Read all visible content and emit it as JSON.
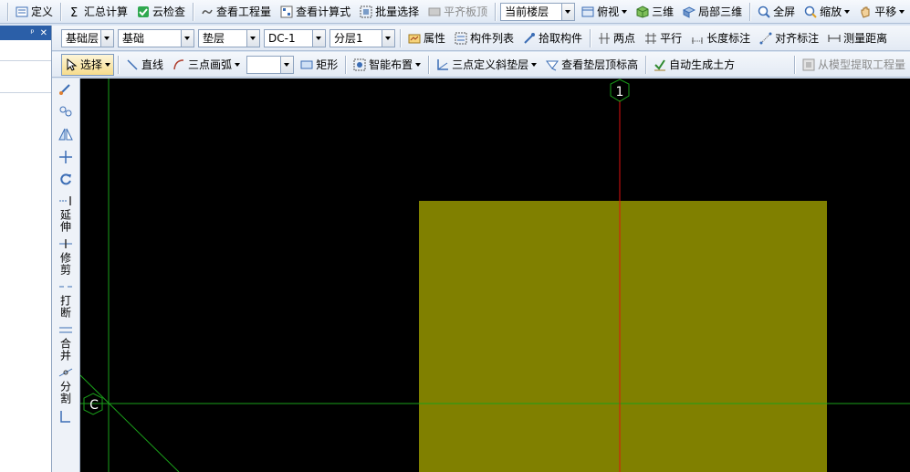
{
  "colors": {
    "canvas_bg": "#000000",
    "cushion_fill": "#808000",
    "axis_red": "#e01010",
    "axis_green": "#1aa01a",
    "axis_label": "#ffffff"
  },
  "toolbar1": {
    "define": "定义",
    "sum_calc": "汇总计算",
    "cloud_check": "云检查",
    "view_quantity": "查看工程量",
    "view_formula": "查看计算式",
    "batch_select": "批量选择",
    "align_slab_top": "平齐板顶",
    "floor_scope": "当前楼层",
    "top_view": "俯视",
    "three_d": "三维",
    "local_3d": "局部三维",
    "fullscreen": "全屏",
    "zoom": "缩放",
    "pan": "平移"
  },
  "toolbar2": {
    "floor": "基础层",
    "category": "基础",
    "type": "垫层",
    "component": "DC-1",
    "layer": "分层1",
    "properties": "属性",
    "component_list": "构件列表",
    "pick_component": "拾取构件",
    "two_points": "两点",
    "parallel": "平行",
    "length_dim": "长度标注",
    "align_dim": "对齐标注",
    "measure_distance": "测量距离"
  },
  "toolbar3": {
    "select": "选择",
    "line": "直线",
    "arc": "三点画弧",
    "arc_combo": "",
    "rectangle": "矩形",
    "smart_layout": "智能布置",
    "define_slope": "三点定义斜垫层",
    "view_cushion_top": "查看垫层顶标高",
    "auto_earthwork": "自动生成土方",
    "extract_from_model": "从模型提取工程量"
  },
  "panel": {
    "pin": "ᵖ",
    "close": "✕"
  },
  "vtools": {
    "extend": "延伸",
    "trim": "修剪",
    "break": "打断",
    "merge": "合并",
    "split": "分割"
  },
  "canvas": {
    "axis_1": "1",
    "axis_c": "C"
  }
}
